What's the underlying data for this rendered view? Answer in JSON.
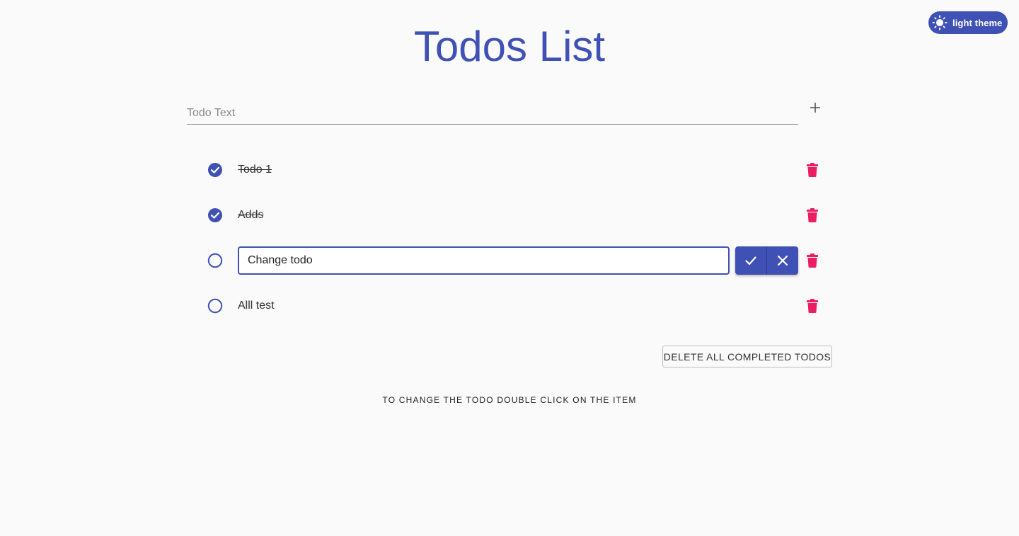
{
  "theme_toggle": {
    "label": "light theme",
    "icon": "sun-icon"
  },
  "title": "Todos List",
  "new_todo": {
    "placeholder": "Todo Text",
    "value": "",
    "add_icon": "plus-icon"
  },
  "todos": [
    {
      "text": "Todo 1",
      "completed": true,
      "editing": false
    },
    {
      "text": "Adds",
      "completed": true,
      "editing": false
    },
    {
      "text": "Change todo",
      "completed": false,
      "editing": true
    },
    {
      "text": "Alll test",
      "completed": false,
      "editing": false
    }
  ],
  "edit_actions": {
    "confirm_icon": "checkmark-icon",
    "cancel_icon": "close-icon"
  },
  "delete_completed_label": "DELETE ALL COMPLETED TODOS",
  "hint": "TO CHANGE THE TODO DOUBLE CLICK ON THE ITEM",
  "colors": {
    "primary": "#3f51b5",
    "delete": "#e91e63",
    "background": "#fafafa"
  }
}
